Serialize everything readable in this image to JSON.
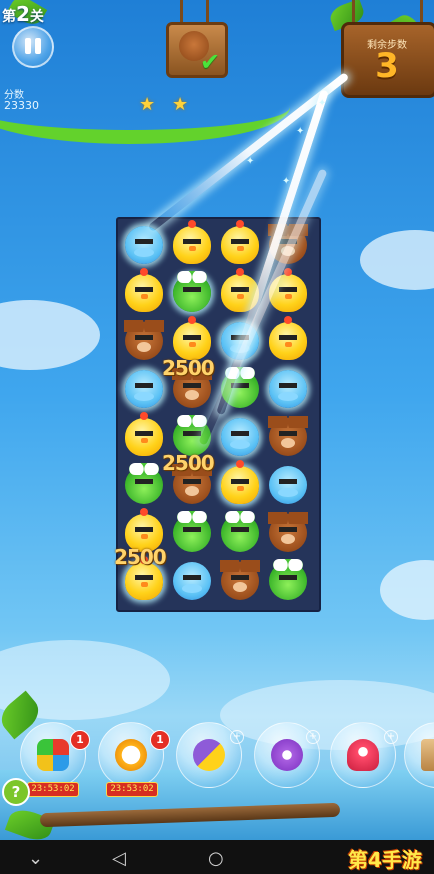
{
  "hud": {
    "level_prefix": "第",
    "level_number": "2",
    "level_suffix": "关",
    "score_label": "分数",
    "score_value": "23330",
    "stars_earned": 2,
    "goal_icon": "bear-icon",
    "goal_complete": true,
    "moves_label": "剩余步数",
    "moves_value": "3"
  },
  "board": {
    "columns": 4,
    "rows": 8,
    "grid": [
      [
        "hippo",
        "chick",
        "chick",
        "bear"
      ],
      [
        "chick",
        "frog",
        "chick",
        "chick"
      ],
      [
        "bear",
        "chick",
        "hippo",
        "chick"
      ],
      [
        "hippo",
        "bear",
        "frog",
        "hippo"
      ],
      [
        "chick",
        "frog",
        "hippo",
        "bear"
      ],
      [
        "frog",
        "bear",
        "chick",
        "hippo"
      ],
      [
        "chick",
        "frog",
        "frog",
        "bear"
      ],
      [
        "chick",
        "hippo",
        "bear",
        "frog"
      ]
    ],
    "score_popups": [
      "2500",
      "2500",
      "2500"
    ]
  },
  "boosters": [
    {
      "name": "shuffle-booster",
      "icon": "shuffle-icon",
      "badge": "1",
      "timer": "23:53:02"
    },
    {
      "name": "undo-booster",
      "icon": "undo-clock-icon",
      "badge": "1",
      "timer": "23:53:02"
    },
    {
      "name": "swap-booster",
      "icon": "swap-icon",
      "badge": "+",
      "timer": ""
    },
    {
      "name": "hammer-booster",
      "icon": "hammer-icon",
      "badge": "+",
      "timer": ""
    },
    {
      "name": "rocket-booster",
      "icon": "rocket-icon",
      "badge": "+",
      "timer": ""
    },
    {
      "name": "extra-booster",
      "icon": "scroll-icon",
      "badge": "",
      "timer": ""
    }
  ],
  "help_label": "?",
  "watermark": "第4手游",
  "colors": {
    "chick": "#ffd21a",
    "frog": "#3bb52a",
    "bear": "#9a4d1b",
    "hippo": "#5cc2f5",
    "moves_digit": "#ffb627",
    "timer_bg": "#d72e22"
  }
}
